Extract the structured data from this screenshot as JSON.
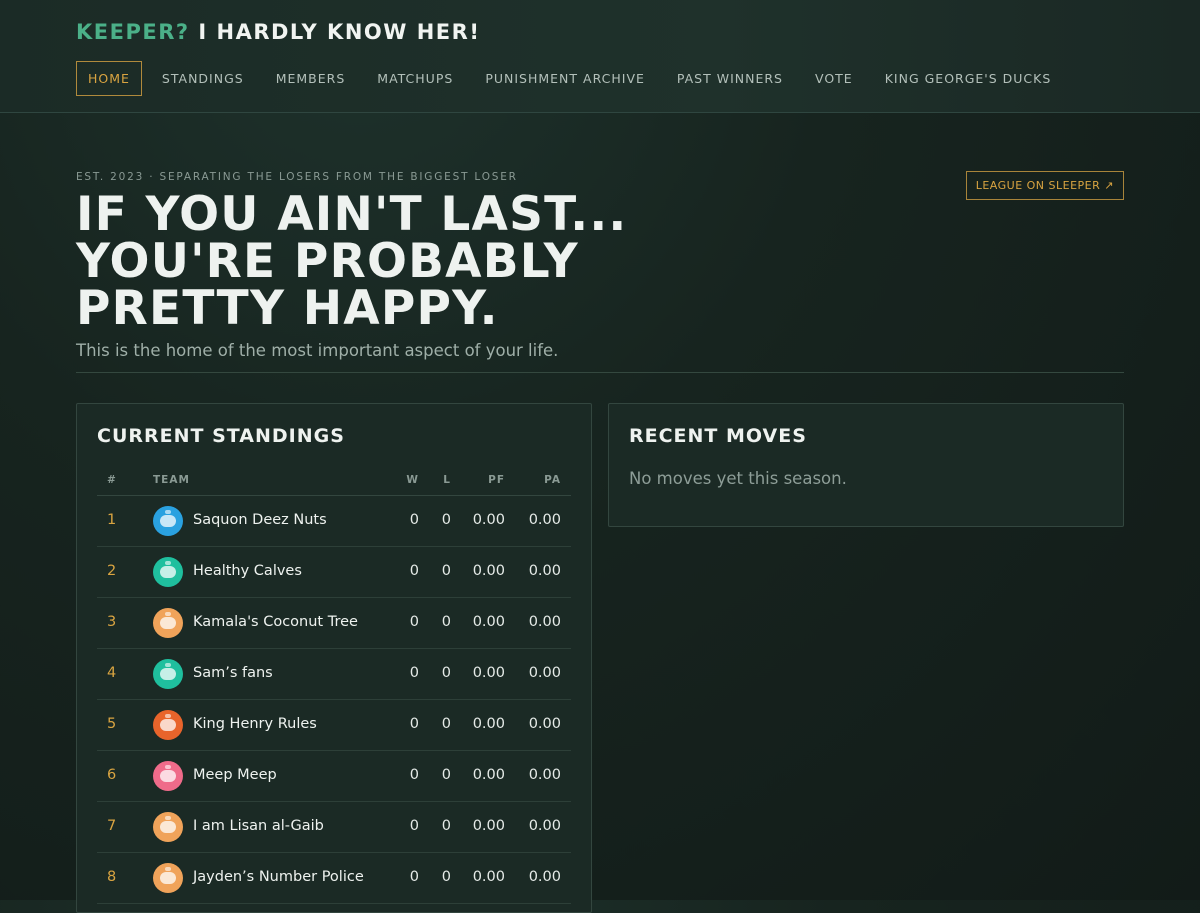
{
  "brand": {
    "accent": "KEEPER?",
    "rest": " I HARDLY KNOW HER!"
  },
  "nav": [
    {
      "label": "HOME",
      "active": true
    },
    {
      "label": "STANDINGS"
    },
    {
      "label": "MEMBERS"
    },
    {
      "label": "MATCHUPS"
    },
    {
      "label": "PUNISHMENT ARCHIVE"
    },
    {
      "label": "PAST WINNERS"
    },
    {
      "label": "VOTE"
    },
    {
      "label": "KING GEORGE'S DUCKS"
    }
  ],
  "hero": {
    "eyebrow": "EST. 2023 · SEPARATING THE LOSERS FROM THE BIGGEST LOSER",
    "headline": "IF YOU AIN'T LAST... YOU'RE PROBABLY PRETTY HAPPY.",
    "subline": "This is the home of the most important aspect of your life.",
    "sleeper_button": "LEAGUE ON SLEEPER ↗"
  },
  "standings": {
    "title": "CURRENT STANDINGS",
    "columns": {
      "rank": "#",
      "team": "TEAM",
      "w": "W",
      "l": "L",
      "pf": "PF",
      "pa": "PA"
    },
    "rows": [
      {
        "rank": "1",
        "team": "Saquon Deez Nuts",
        "w": "0",
        "l": "0",
        "pf": "0.00",
        "pa": "0.00",
        "avatar_color": "#2aa1e0",
        "avatar_icon": "robot-avatar-icon"
      },
      {
        "rank": "2",
        "team": "Healthy Calves",
        "w": "0",
        "l": "0",
        "pf": "0.00",
        "pa": "0.00",
        "avatar_color": "#1fbf9e",
        "avatar_icon": "robot-avatar-icon"
      },
      {
        "rank": "3",
        "team": "Kamala's Coconut Tree",
        "w": "0",
        "l": "0",
        "pf": "0.00",
        "pa": "0.00",
        "avatar_color": "#f0a35a",
        "avatar_icon": "robot-avatar-icon"
      },
      {
        "rank": "4",
        "team": "Sam’s fans",
        "w": "0",
        "l": "0",
        "pf": "0.00",
        "pa": "0.00",
        "avatar_color": "#1fbf9e",
        "avatar_icon": "robot-avatar-icon"
      },
      {
        "rank": "5",
        "team": "King Henry Rules",
        "w": "0",
        "l": "0",
        "pf": "0.00",
        "pa": "0.00",
        "avatar_color": "#e8642b",
        "avatar_icon": "robot-avatar-icon"
      },
      {
        "rank": "6",
        "team": "Meep Meep",
        "w": "0",
        "l": "0",
        "pf": "0.00",
        "pa": "0.00",
        "avatar_color": "#ef6b8a",
        "avatar_icon": "robot-avatar-icon"
      },
      {
        "rank": "7",
        "team": "I am Lisan al-Gaib",
        "w": "0",
        "l": "0",
        "pf": "0.00",
        "pa": "0.00",
        "avatar_color": "#f0a35a",
        "avatar_icon": "robot-avatar-icon"
      },
      {
        "rank": "8",
        "team": "Jayden’s Number Police",
        "w": "0",
        "l": "0",
        "pf": "0.00",
        "pa": "0.00",
        "avatar_color": "#f0a35a",
        "avatar_icon": "robot-avatar-icon"
      }
    ]
  },
  "moves": {
    "title": "RECENT MOVES",
    "empty": "No moves yet this season."
  },
  "colors": {
    "accent_green": "#4bb088",
    "accent_gold": "#d9a441",
    "background": "#17241f"
  }
}
